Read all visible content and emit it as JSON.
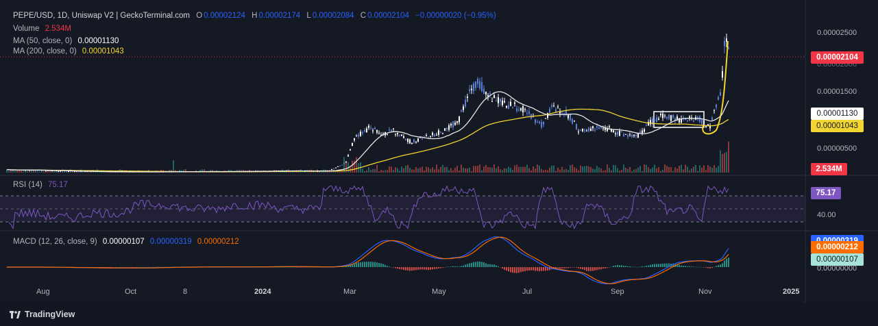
{
  "header": {
    "symbol": "PEPE/USD, 1D, Uniswap V2 | GeckoTerminal.com",
    "o_label": "O",
    "o_value": "0.00002124",
    "h_label": "H",
    "h_value": "0.00002174",
    "l_label": "L",
    "l_value": "0.00002084",
    "c_label": "C",
    "c_value": "0.00002104",
    "change": "−0.00000020 (−0.95%)",
    "volume_label": "Volume",
    "volume_value": "2.534M",
    "ma50_label": "MA (50, close, 0)",
    "ma50_value": "0.00001130",
    "ma200_label": "MA (200, close, 0)",
    "ma200_value": "0.00001043"
  },
  "price_axis": {
    "ticks": [
      "0.00002500",
      "0.00002000",
      "0.00001500",
      "0.00000500"
    ],
    "current_price": "0.00002104",
    "ma50_tag": "0.00001130",
    "ma200_tag": "0.00001043",
    "volume_tag": "2.534M"
  },
  "rsi": {
    "label": "RSI (14)",
    "value": "75.17",
    "axis_tick": "40.00",
    "tag": "75.17"
  },
  "macd": {
    "label": "MACD (12, 26, close, 9)",
    "macd_value": "0.00000107",
    "signal_value": "0.00000319",
    "hist_value": "0.00000212",
    "tag_blue": "0.00000319",
    "tag_orange": "0.00000212",
    "tag_teal": "0.00000107",
    "axis_tick": "0.00000000"
  },
  "time_axis": {
    "labels": [
      "Aug",
      "Oct",
      "8",
      "2024",
      "Mar",
      "May",
      "Jul",
      "Sep",
      "Nov",
      "2025"
    ]
  },
  "footer": {
    "brand": "TradingView"
  },
  "colors": {
    "background": "#151924",
    "candle": "#5b7fd6",
    "ma50": "#e8e8e8",
    "ma200": "#f2d531",
    "price_tag": "#f23645",
    "rsi": "#7e57c2",
    "macd": "#2962ff",
    "signal": "#ff6d00",
    "hist": "#26a69a"
  },
  "chart_data": {
    "type": "line",
    "series": [
      {
        "name": "PEPE/USD",
        "x": [
          "Aug",
          "Oct",
          "2024",
          "Mar",
          "May",
          "Jul",
          "Sep",
          "Nov"
        ],
        "values": [
          1.2e-06,
          8e-07,
          1e-06,
          7e-06,
          1.6e-05,
          1.2e-05,
          9e-06,
          2.1e-05
        ]
      },
      {
        "name": "MA (50, close, 0)",
        "x": [
          "Aug",
          "Oct",
          "2024",
          "Mar",
          "May",
          "Jul",
          "Sep",
          "Nov"
        ],
        "values": [
          1.1e-06,
          9e-07,
          1e-06,
          3e-06,
          1.1e-05,
          1.3e-05,
          9.5e-06,
          1.13e-05
        ]
      },
      {
        "name": "MA (200, close, 0)",
        "x": [
          "Aug",
          "Oct",
          "2024",
          "Mar",
          "May",
          "Jul",
          "Sep",
          "Nov"
        ],
        "values": [
          1.2e-06,
          1.1e-06,
          1e-06,
          1.5e-06,
          4.5e-06,
          7e-06,
          9.5e-06,
          1.04e-05
        ]
      }
    ]
  }
}
